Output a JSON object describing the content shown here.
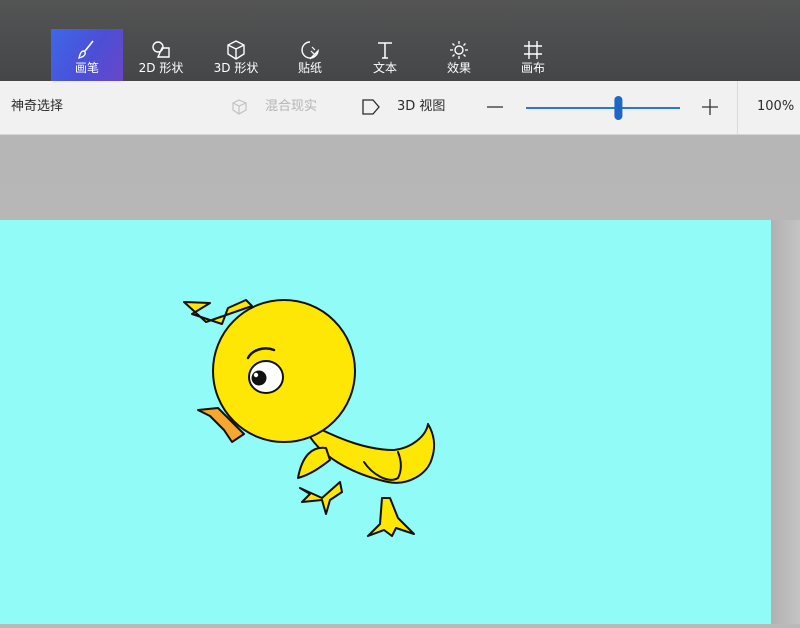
{
  "ribbon": {
    "tools": [
      {
        "label": "画笔",
        "icon": "brush-icon",
        "active": true
      },
      {
        "label": "2D 形状",
        "icon": "shapes-2d-icon",
        "active": false
      },
      {
        "label": "3D 形状",
        "icon": "cube-icon",
        "active": false
      },
      {
        "label": "贴纸",
        "icon": "sticker-icon",
        "active": false
      },
      {
        "label": "文本",
        "icon": "text-icon",
        "active": false
      },
      {
        "label": "效果",
        "icon": "sun-icon",
        "active": false
      },
      {
        "label": "画布",
        "icon": "canvas-icon",
        "active": false
      }
    ],
    "active_color": "#4a57db"
  },
  "subbar": {
    "magic_select": "神奇选择",
    "mixed_reality": "混合现实",
    "view_3d": "3D 视图",
    "zoom_level": 0.6,
    "zoom_percent": "100%"
  },
  "canvas": {
    "background_color": "#91fbf7",
    "drawing": "yellow-duckling"
  }
}
